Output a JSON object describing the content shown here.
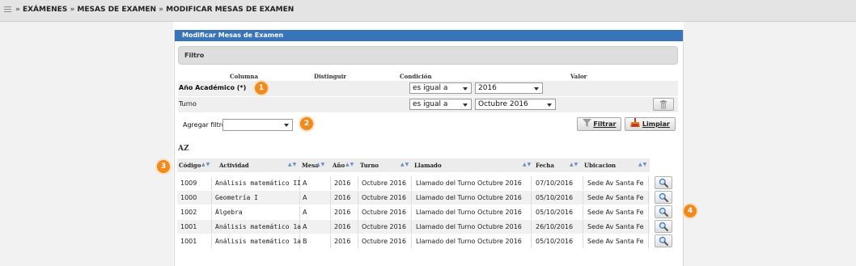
{
  "breadcrumb": {
    "separator": "»",
    "items": [
      "EXÁMENES",
      "MESAS DE EXAMEN",
      "MODIFICAR MESAS DE EXAMEN"
    ]
  },
  "panel": {
    "title": "Modificar Mesas de Examen"
  },
  "filter": {
    "title": "Filtro",
    "headers": {
      "column": "Columna",
      "distinguish": "Distinguir",
      "condition": "Condición",
      "value": "Valor"
    },
    "rows": [
      {
        "label": "Año Académico (*)",
        "condition": "es igual a",
        "value": "2016"
      },
      {
        "label": "Turno",
        "condition": "es igual a",
        "value": "Octubre 2016"
      }
    ],
    "add_filter_label": "Agregar filtro",
    "add_filter_value": "",
    "filter_button": "Filtrar",
    "clear_button": "Limpiar"
  },
  "sort_icon_label": "AZ",
  "table": {
    "columns": [
      "Código",
      "Actividad",
      "Mesa",
      "Año",
      "Turno",
      "Llamado",
      "Fecha",
      "Ubicacion"
    ],
    "rows": [
      [
        "1009",
        "Análisis matemático II",
        "A",
        "2016",
        "Octubre 2016",
        "Llamado del Turno Octubre 2016",
        "07/10/2016",
        "Sede Av Santa Fe"
      ],
      [
        "1000",
        "Geometría I",
        "A",
        "2016",
        "Octubre 2016",
        "Llamado del Turno Octubre 2016",
        "05/10/2016",
        "Sede Av Santa Fe"
      ],
      [
        "1002",
        "Álgebra",
        "A",
        "2016",
        "Octubre 2016",
        "Llamado del Turno Octubre 2016",
        "05/10/2016",
        "Sede Av Santa Fe"
      ],
      [
        "1001",
        "Análisis matemático 1a",
        "A",
        "2016",
        "Octubre 2016",
        "Llamado del Turno Octubre 2016",
        "26/10/2016",
        "Sede Av Santa Fe"
      ],
      [
        "1001",
        "Análisis matemático 1a",
        "B",
        "2016",
        "Octubre 2016",
        "Llamado del Turno Octubre 2016",
        "05/10/2016",
        "Sede Av Santa Fe"
      ]
    ]
  },
  "badges": [
    "1",
    "2",
    "3",
    "4"
  ],
  "icons": {
    "menu": "menu-icon",
    "delete": "trash-icon",
    "filter": "funnel-icon",
    "clear": "broom-icon",
    "view": "magnifier-icon",
    "sort": "sort-arrows-icon"
  },
  "colors": {
    "panel_header": "#3973b8",
    "badge": "#f08a1c",
    "sort_arrow": "#6b8fbf"
  }
}
